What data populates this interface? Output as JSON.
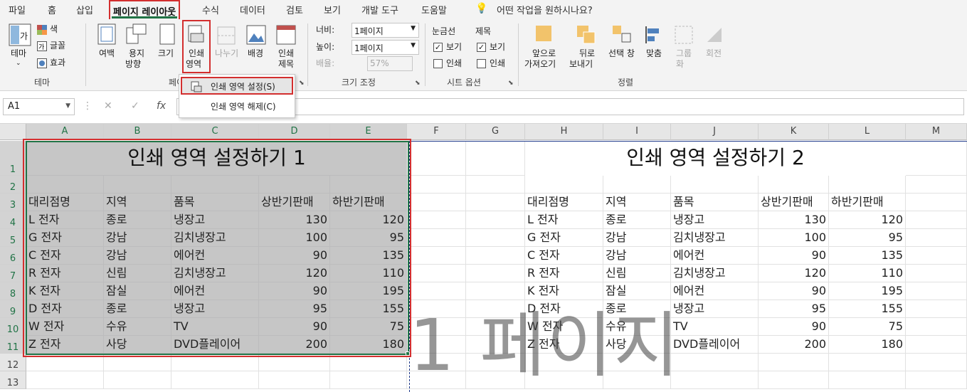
{
  "tabs": [
    "파일",
    "홈",
    "삽입",
    "페이지 레이아웃",
    "수식",
    "데이터",
    "검토",
    "보기",
    "개발 도구",
    "도움말"
  ],
  "tell_me": "어떤 작업을 원하시나요?",
  "ribbon": {
    "theme": {
      "themes": "테마",
      "colors": "색",
      "fonts": "글꼴",
      "effects": "효과",
      "group": "테마"
    },
    "page_setup": {
      "margins": "여백",
      "orientation_1": "용지",
      "orientation_2": "방향",
      "size": "크기",
      "print_area_1": "인쇄",
      "print_area_2": "영역",
      "breaks": "나누기",
      "background": "배경",
      "print_titles_1": "인쇄",
      "print_titles_2": "제목",
      "group": "페이"
    },
    "scale": {
      "width_label": "너비:",
      "width_value": "1페이지",
      "height_label": "높이:",
      "height_value": "1페이지",
      "scale_label": "배율:",
      "scale_value": "57%",
      "group": "크기 조정"
    },
    "sheet_options": {
      "gridlines": "눈금선",
      "headings": "제목",
      "view1": "보기",
      "print1": "인쇄",
      "view2": "보기",
      "print2": "인쇄",
      "group": "시트 옵션"
    },
    "arrange": {
      "bring_forward_1": "앞으로",
      "bring_forward_2": "가져오기",
      "send_backward_1": "뒤로",
      "send_backward_2": "보내기",
      "selection_pane": "선택 창",
      "align": "맞춤",
      "group_1": "그룹",
      "group_2": "화",
      "rotate": "회전",
      "group": "정렬"
    }
  },
  "dropdown": {
    "set": "인쇄 영역 설정(S)",
    "clear": "인쇄 영역 해제(C)"
  },
  "formula": {
    "namebox": "A1",
    "fx": "fx",
    "cancel": "✕",
    "enter": "✓"
  },
  "columns": [
    "A",
    "B",
    "C",
    "D",
    "E",
    "F",
    "G",
    "H",
    "I",
    "J",
    "K",
    "L",
    "M"
  ],
  "rows": [
    "1",
    "2",
    "3",
    "4",
    "5",
    "6",
    "7",
    "8",
    "9",
    "10",
    "11",
    "12",
    "13"
  ],
  "table1": {
    "title": "인쇄 영역 설정하기 1",
    "headers": [
      "대리점명",
      "지역",
      "품목",
      "상반기판매",
      "하반기판매"
    ],
    "rows": [
      [
        "L 전자",
        "종로",
        "냉장고",
        "130",
        "120"
      ],
      [
        "G 전자",
        "강남",
        "김치냉장고",
        "100",
        "95"
      ],
      [
        "C 전자",
        "강남",
        "에어컨",
        "90",
        "135"
      ],
      [
        "R 전자",
        "신림",
        "김치냉장고",
        "120",
        "110"
      ],
      [
        "K 전자",
        "잠실",
        "에어컨",
        "90",
        "195"
      ],
      [
        "D 전자",
        "종로",
        "냉장고",
        "95",
        "155"
      ],
      [
        "W 전자",
        "수유",
        "TV",
        "90",
        "75"
      ],
      [
        "Z 전자",
        "사당",
        "DVD플레이어",
        "200",
        "180"
      ]
    ]
  },
  "table2": {
    "title": "인쇄 영역 설정하기 2",
    "headers": [
      "대리점명",
      "지역",
      "품목",
      "상반기판매",
      "하반기판매"
    ],
    "rows": [
      [
        "L 전자",
        "종로",
        "냉장고",
        "130",
        "120"
      ],
      [
        "G 전자",
        "강남",
        "김치냉장고",
        "100",
        "95"
      ],
      [
        "C 전자",
        "강남",
        "에어컨",
        "90",
        "135"
      ],
      [
        "R 전자",
        "신림",
        "김치냉장고",
        "120",
        "110"
      ],
      [
        "K 전자",
        "잠실",
        "에어컨",
        "90",
        "195"
      ],
      [
        "D 전자",
        "종로",
        "냉장고",
        "95",
        "155"
      ],
      [
        "W 전자",
        "수유",
        "TV",
        "90",
        "75"
      ],
      [
        "Z 전자",
        "사당",
        "DVD플레이어",
        "200",
        "180"
      ]
    ]
  },
  "watermark": "1 페이지",
  "colors": {
    "accent": "#217346",
    "highlight": "#d32f2f",
    "shade": "#c6c6c6"
  }
}
